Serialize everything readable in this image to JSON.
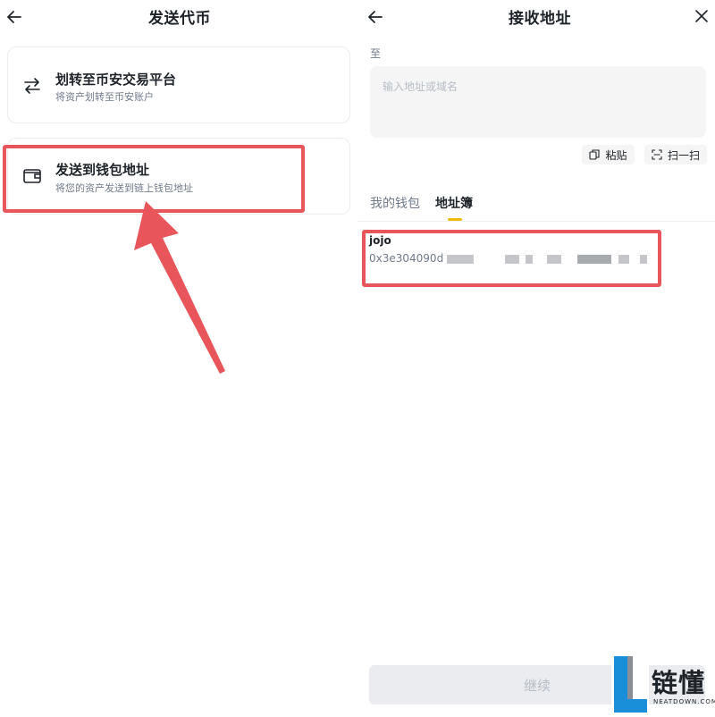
{
  "left_screen": {
    "title": "发送代币",
    "options": [
      {
        "title": "划转至币安交易平台",
        "subtitle": "将资产划转至币安账户",
        "icon": "transfer-arrows-icon"
      },
      {
        "title": "发送到钱包地址",
        "subtitle": "将您的资产发送到链上钱包地址",
        "icon": "wallet-icon"
      }
    ]
  },
  "right_screen": {
    "title": "接收地址",
    "to_label": "至",
    "address_input": {
      "value": "",
      "placeholder": "输入地址或域名"
    },
    "paste_label": "粘贴",
    "scan_label": "扫一扫",
    "tabs": [
      {
        "label": "我的钱包",
        "active": false
      },
      {
        "label": "地址簿",
        "active": true
      }
    ],
    "address_book": [
      {
        "name": "jojo",
        "address": "0x3e304090d"
      }
    ],
    "continue_label": "继续"
  },
  "watermark": {
    "brand": "链懂",
    "site": "NEATDOWN.COM"
  },
  "colors": {
    "highlight": "#e8565b",
    "accent": "#f0b90b",
    "watermark_blue": "#1a8fd9"
  }
}
